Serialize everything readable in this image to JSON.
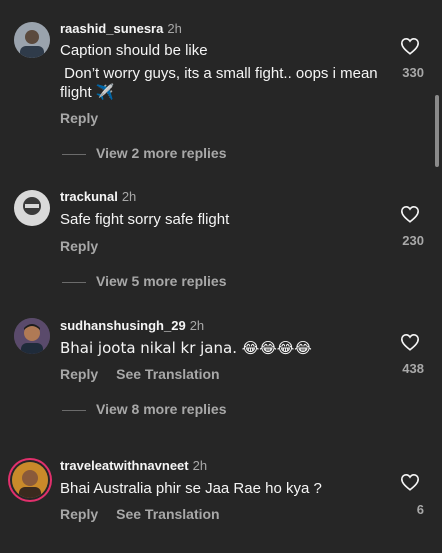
{
  "comments": [
    {
      "username": "raashid_sunesra",
      "time": "2h",
      "text_lines": [
        "Caption should be like",
        " Don’t worry guys, its a small fight.. oops i mean flight ✈️"
      ],
      "reply": "Reply",
      "likes": "330",
      "view_more": "View 2 more replies"
    },
    {
      "username": "trackunal",
      "time": "2h",
      "text": "Safe fight sorry safe flight",
      "reply": "Reply",
      "likes": "230",
      "view_more": "View 5 more replies"
    },
    {
      "username": "sudhanshusingh_29",
      "time": "2h",
      "text": "Bhai joota nikal kr jana. 😂😂😂😂",
      "reply": "Reply",
      "translate": "See Translation",
      "likes": "438",
      "view_more": "View 8 more replies"
    },
    {
      "username": "traveleatwithnavneet",
      "time": "2h",
      "text": "Bhai Australia phir se Jaa Rae ho kya ?",
      "reply": "Reply",
      "translate": "See Translation",
      "likes": "6"
    }
  ],
  "colors": {
    "background": "#262626",
    "muted": "#a8a8a8",
    "story_ring": "#e1306c"
  },
  "icons": {
    "like": "heart-outline-icon"
  }
}
